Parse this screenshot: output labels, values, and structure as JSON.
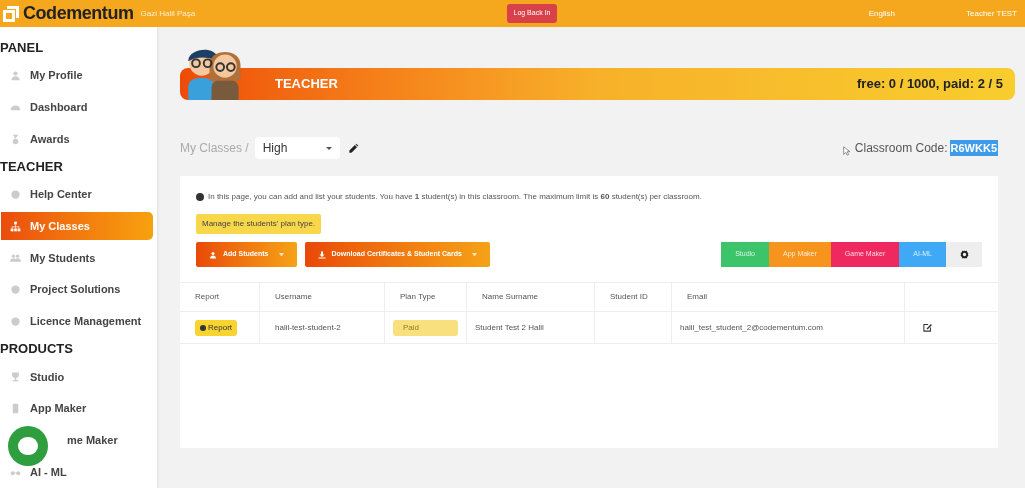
{
  "topbar": {
    "brand": "Codementum",
    "user_note": "Gazi Halil Paşa",
    "log_back_button": "Log Back In",
    "language": "English",
    "user": "Teacher TEST"
  },
  "sidebar": {
    "sections": [
      {
        "title": "PANEL",
        "items": [
          {
            "label": "My Profile",
            "selected": false
          },
          {
            "label": "Dashboard",
            "selected": false
          },
          {
            "label": "Awards",
            "selected": false
          }
        ]
      },
      {
        "title": "TEACHER",
        "items": [
          {
            "label": "Help Center",
            "selected": false
          },
          {
            "label": "My Classes",
            "selected": true
          },
          {
            "label": "My Students",
            "selected": false
          },
          {
            "label": "Project Solutions",
            "selected": false
          },
          {
            "label": "Licence Management",
            "selected": false
          }
        ]
      },
      {
        "title": "PRODUCTS",
        "items": [
          {
            "label": "Studio",
            "selected": false
          },
          {
            "label": "App Maker",
            "selected": false
          },
          {
            "label": "me Maker",
            "selected": false
          },
          {
            "label": "AI - ML",
            "selected": false
          }
        ]
      }
    ]
  },
  "banner": {
    "title": "TEACHER",
    "quota": "free: 0 / 1000, paid: 2 / 5"
  },
  "breadcrumb": {
    "label": "My Classes /",
    "class_select": "High"
  },
  "classroom_code": {
    "label": "Classroom Code:",
    "code": "R6WKK5"
  },
  "info": "In this page, you can add and list your students. You have **1** student(s) in this classroom. The maximum limit is **60** student(s) per classroom.",
  "plan_button": "Manage the students' plan type.",
  "actions": [
    "Add Students",
    "Download Certificates & Student Cards"
  ],
  "product_filters": [
    {
      "label": "Studio",
      "color": "#3cc46a"
    },
    {
      "label": "App Maker",
      "color": "#f7941d"
    },
    {
      "label": "Game Maker",
      "color": "#ef2860"
    },
    {
      "label": "AI-ML",
      "color": "#3fa9f5"
    }
  ],
  "table": {
    "columns": [
      "Report",
      "Username",
      "Plan Type",
      "Name Surname",
      "Student ID",
      "Email"
    ],
    "rows": [
      {
        "report": "Report",
        "username": "halil-test-student-2",
        "plan_type": "Paid",
        "name": "Student Test 2 Halil",
        "email": "halil_test_student_2@codementum.com"
      }
    ]
  }
}
